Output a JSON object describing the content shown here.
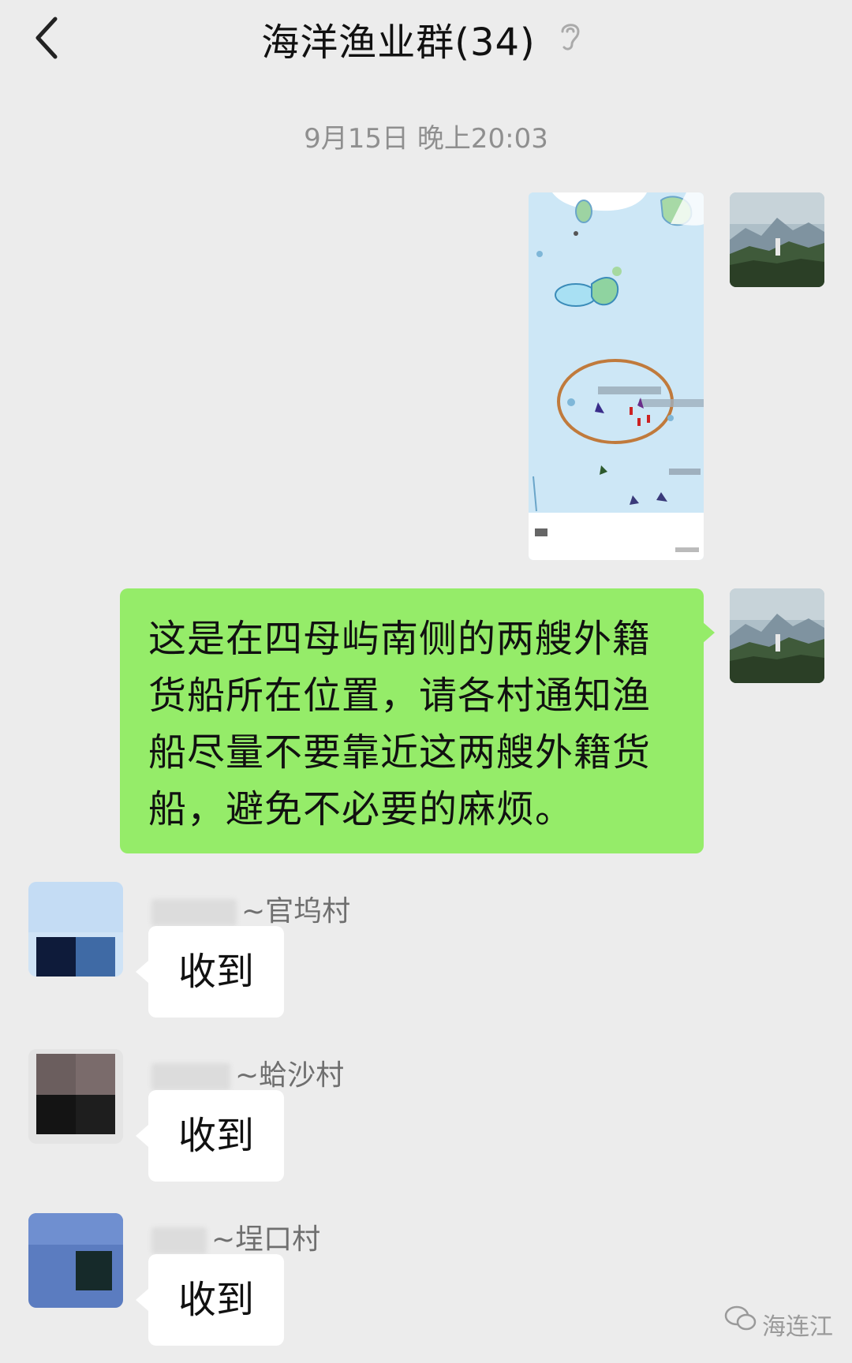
{
  "header": {
    "title": "海洋渔业群(34)",
    "back_icon": "back-chevron-icon",
    "earpiece_icon": "ear-icon"
  },
  "timestamp": "9月15日 晚上20:03",
  "messages": {
    "outgoing_text": "这是在四母屿南侧的两艘外籍货船所在位置，请各村通知渔船尽量不要靠近这两艘外籍货船，避免不必要的麻烦。",
    "incoming": [
      {
        "sender_suffix": "~官坞村",
        "text": "收到"
      },
      {
        "sender_suffix": "~蛤沙村",
        "text": "收到"
      },
      {
        "sender_suffix": "~埕口村",
        "text": "收到"
      }
    ]
  },
  "watermark": "海连江",
  "colors": {
    "background": "#ececec",
    "outgoing_bubble": "#95ec69",
    "incoming_bubble": "#ffffff",
    "timestamp_text": "#8f8f8f"
  }
}
